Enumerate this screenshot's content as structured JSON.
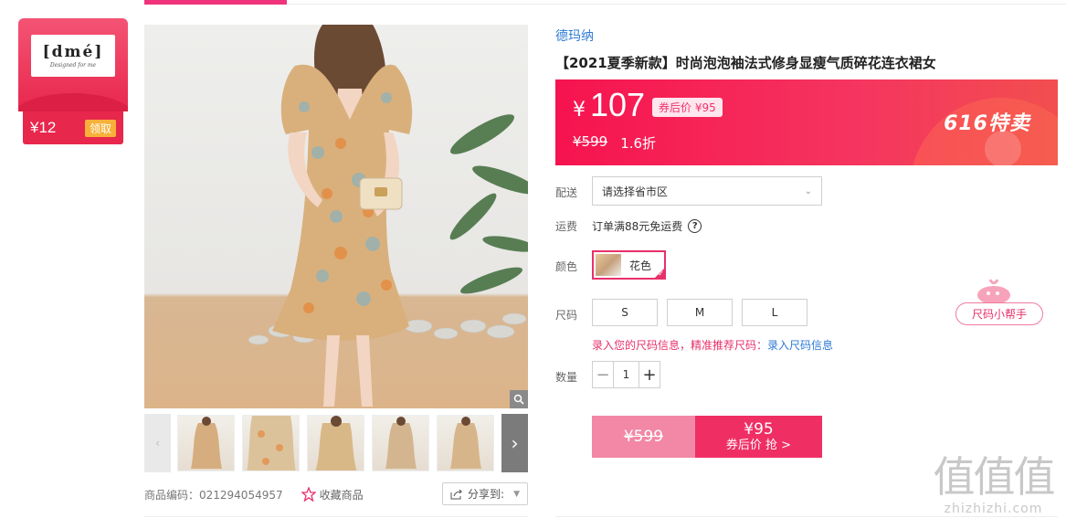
{
  "coupon": {
    "amount": "¥12",
    "claim_label": "领取",
    "logo_text": "[dmé]",
    "logo_tagline": "Designed for me"
  },
  "gallery": {
    "zoom_icon": "magnifier-icon",
    "thumbnails_count_visible": 5
  },
  "meta": {
    "sku": "商品编码：021294054957",
    "favorite_label": "收藏商品",
    "share_label": "分享到:"
  },
  "product": {
    "brand": "德玛纳",
    "title": "【2021夏季新款】时尚泡泡袖法式修身显瘦气质碎花连衣裙女"
  },
  "price": {
    "currency": "¥",
    "current": "107",
    "after_coupon": "券后价 ¥95",
    "original": "¥599",
    "discount": "1.6折",
    "promo": "616特卖"
  },
  "shipping": {
    "label": "配送",
    "placeholder": "请选择省市区",
    "fee_label": "运费",
    "fee_text": "订单满88元免运费"
  },
  "color": {
    "label": "颜色",
    "selected": "花色"
  },
  "size": {
    "label": "尺码",
    "options": [
      "S",
      "M",
      "L"
    ],
    "note": "录入您的尺码信息，精准推荐尺码：",
    "note_link": "录入尺码信息"
  },
  "quantity": {
    "label": "数量",
    "value": "1",
    "minus": "−",
    "plus": "+"
  },
  "buy": {
    "original": "¥599",
    "coupon_price": "¥95",
    "coupon_action": "券后价 抢 >"
  },
  "helper": {
    "label": "尺码小帮手"
  },
  "watermark": {
    "big": "值值值",
    "small": "zhizhizhi.com"
  },
  "colors": {
    "accent": "#f0337d",
    "brand_link": "#2d7ad6",
    "price_band": "#f6134f"
  }
}
